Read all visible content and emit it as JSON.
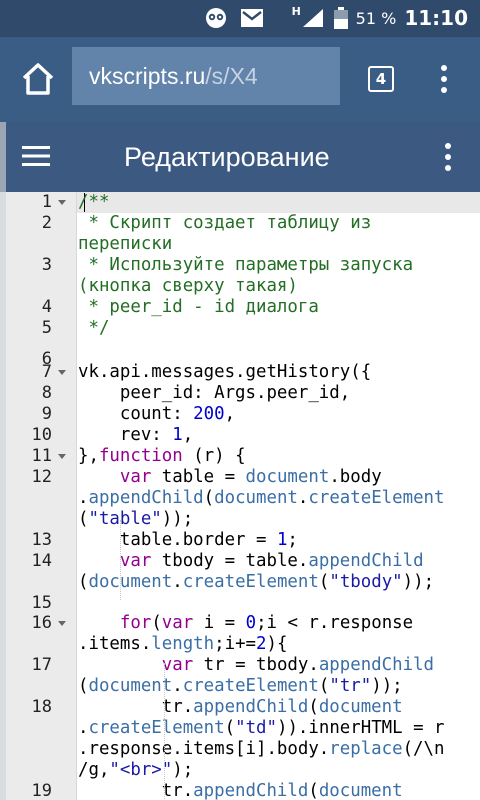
{
  "status_bar": {
    "network": "H",
    "battery": "51 %",
    "time": "11:10"
  },
  "browser": {
    "url_host": "vkscripts.ru",
    "url_path": "/s/X4",
    "tab_count": "4"
  },
  "app_bar": {
    "title": "Редактирование"
  },
  "editor": {
    "line_numbers": [
      "1",
      "2",
      "3",
      "4",
      "5",
      "6",
      "7",
      "8",
      "9",
      "10",
      "11",
      "12",
      "13",
      "14",
      "15",
      "16",
      "17",
      "18",
      "19"
    ],
    "code": [
      "/**",
      " * Скрипт создает таблицу из",
      "переписки",
      " * Используйте параметры запуска",
      "(кнопка сверху такая)",
      " * peer_id - id диалога",
      " */",
      "",
      "vk.api.messages.getHistory({",
      "    peer_id: Args.peer_id,",
      "    count: 200,",
      "    rev: 1,",
      "},function (r) {",
      "    var table = document.body",
      ".appendChild(document.createElement",
      "(\"table\"));",
      "    table.border = 1;",
      "    var tbody = table.appendChild",
      "(document.createElement(\"tbody\"));",
      "",
      "    for(var i = 0;i < r.response",
      ".items.length;i+=2){",
      "        var tr = tbody.appendChild",
      "(document.createElement(\"tr\"));",
      "        tr.appendChild(document",
      ".createElement(\"td\")).innerHTML = r",
      ".response.items[i].body.replace(/\\n",
      "/g,\"<br>\");",
      "        tr.appendChild(document"
    ]
  },
  "icons": {
    "status_left": "owl-icon",
    "mail": "mail-icon",
    "signal": "signal-icon",
    "battery": "battery-icon",
    "home": "home-icon",
    "menu": "hamburger-menu-icon",
    "more": "more-vert-icon"
  },
  "colors": {
    "status_bar": "#2f4a6b",
    "browser_bar": "#3a5d86",
    "url_box": "#6283aa",
    "app_bar": "#3c5a81",
    "comment": "#236e24",
    "keyword": "#93008f",
    "builtin": "#3a6ea5",
    "number": "#0000cd",
    "string": "#1a1aa6"
  }
}
